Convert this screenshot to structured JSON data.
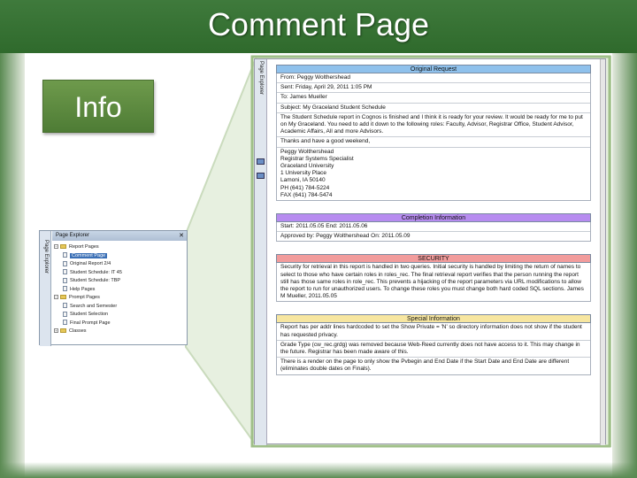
{
  "slide": {
    "title": "Comment Page",
    "info_button": "Info"
  },
  "explorer": {
    "tab_label": "Page Explorer",
    "header": "Page Explorer",
    "close": "✕",
    "tree": [
      {
        "label": "Report Pages",
        "type": "folder",
        "level": 0,
        "expander": "−"
      },
      {
        "label": "Comment Page",
        "type": "page",
        "level": 1,
        "selected": true
      },
      {
        "label": "Original Report 2/4",
        "type": "page",
        "level": 1
      },
      {
        "label": "Student Schedule: IT 45",
        "type": "page",
        "level": 1
      },
      {
        "label": "Student Schedule: TBP",
        "type": "page",
        "level": 1
      },
      {
        "label": "Help Pages",
        "type": "page",
        "level": 1
      },
      {
        "label": "Prompt Pages",
        "type": "folder",
        "level": 0,
        "expander": "−"
      },
      {
        "label": "Search and Semester",
        "type": "page",
        "level": 1
      },
      {
        "label": "Student Selection",
        "type": "page",
        "level": 1
      },
      {
        "label": "Final Prompt Page",
        "type": "page",
        "level": 1
      },
      {
        "label": "Classes",
        "type": "folder",
        "level": 0,
        "expander": "+"
      }
    ]
  },
  "report": {
    "tab_label": "Page Explorer",
    "original_request": {
      "header": "Original Request",
      "rows": [
        "From: Peggy Wolthershead",
        "Sent: Friday, April 29, 2011 1:05 PM",
        "To: James Mueller",
        "Subject: My Graceland Student Schedule",
        "The Student Schedule report in Cognos is finished and I think it is ready for your review. It would be ready for me to put on My Graceland. You need to add it down to the following roles: Faculty, Advisor, Registrar Office, Student Advisor, Academic Affairs, All and more Advisors.",
        "Thanks and have a good weekend,",
        "Peggy Wolthershead\nRegistrar Systems Specialist\nGraceland University\n1 University Place\nLamoni, IA 50140\nPH (641) 784-5224\nFAX (641) 784-5474"
      ]
    },
    "completion": {
      "header": "Completion Information",
      "row1": "Start: 2011.05.05    End: 2011.05.06",
      "row2": "Approved by: Peggy Wolthershead             On: 2011.05.09"
    },
    "security": {
      "header": "SECURITY",
      "text": "Security for retrieval in this report is handled in two queries. Initial security is handled by limiting the return of names to select to those who have certain roles in roles_rec. The final retrieval report verifies that the person running the report still has those same roles in role_rec. This prevents a hijacking of the report parameters via URL modifications to allow the report to run for unauthorized users. To change these roles you must change both hard coded SQL sections. James M Mueller, 2011.05.05"
    },
    "special": {
      "header": "Special Information",
      "rows": [
        "Report has per addr lines hardcoded to set the Show Private = 'N' so directory information does not show if the student has requested privacy.",
        "Grade Type (cw_rec.grdg) was removed because Web-Reed currently does not have access to it. This may change in the future. Registrar has been made aware of this.",
        "There is a render on the page to only show the Pvbegin and End Date if the Start Date and End Date are different (eliminates double dates on Finals)."
      ]
    }
  }
}
